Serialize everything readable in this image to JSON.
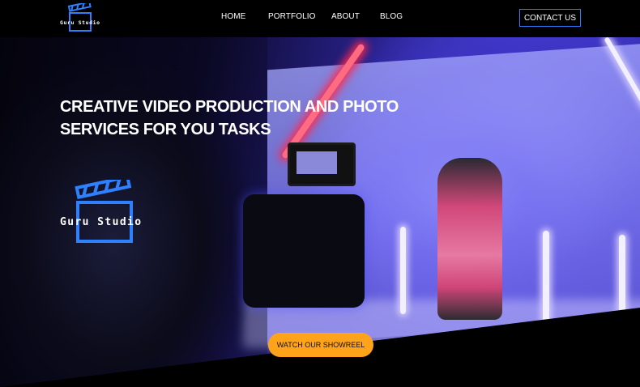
{
  "header": {
    "logo_text": "Guru Studio",
    "nav": [
      {
        "label": "HOME"
      },
      {
        "label": "PORTFOLIO"
      },
      {
        "label": "ABOUT"
      },
      {
        "label": "BLOG"
      }
    ],
    "cta_label": "CONTACT US"
  },
  "hero": {
    "headline_line1": "CREATIVE VIDEO PRODUCTION AND PHOTO",
    "headline_line2": "SERVICES FOR YOU TASKS",
    "logo_text": "Guru Studio",
    "button_label": "WATCH OUR SHOWREEL",
    "image_description_icon": "film-set-photo"
  },
  "colors": {
    "accent_blue": "#2f80ff",
    "button_orange": "#ffa31a",
    "background": "#000000"
  }
}
